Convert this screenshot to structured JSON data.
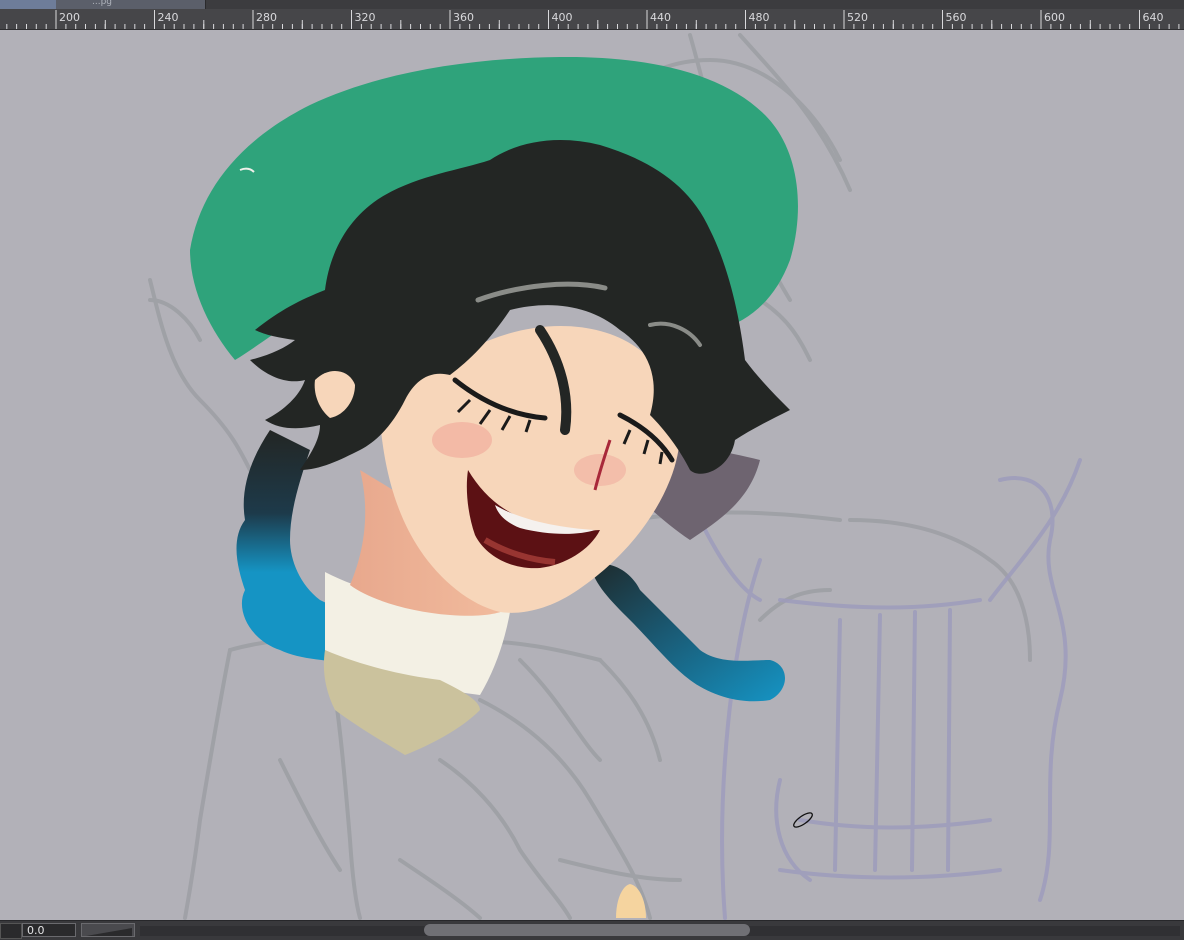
{
  "window": {
    "document_tab_title": "...pg",
    "ruler_labels": [
      "200",
      "240",
      "280",
      "320",
      "360",
      "400",
      "440",
      "480",
      "520",
      "560",
      "600",
      "640"
    ]
  },
  "canvas": {
    "background": "#b2b1b8",
    "artwork": "digital painting in progress: character with green hat, dark hair, blue braids, closed eyes smiling; sketch lines of body and lyre",
    "colors": {
      "hat": "#2fa37b",
      "hair": "#232624",
      "braid": "#1594c4",
      "skin": "#f7d6ba",
      "sketch": "#9c9fa3",
      "lyre_sketch": "#9e9cbc"
    }
  },
  "status_bar": {
    "angle_value": "0.0"
  }
}
